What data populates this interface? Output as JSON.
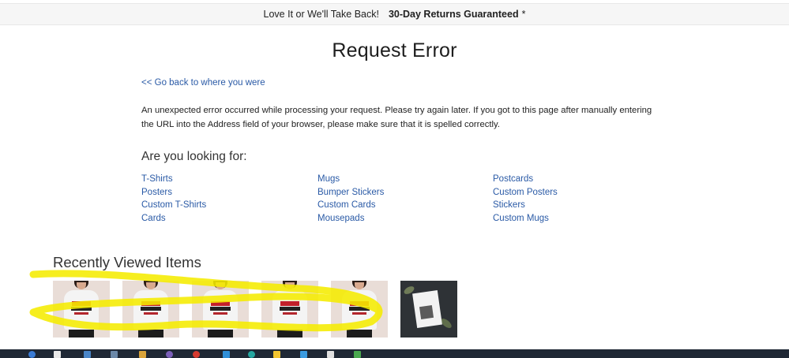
{
  "promo": {
    "text": "Love It or We'll Take Back!",
    "strong": "30-Day Returns Guaranteed",
    "asterisk": "*"
  },
  "title": "Request Error",
  "back_link": "<< Go back to where you were",
  "error_message": "An unexpected error occurred while processing your request. Please try again later. If you got to this page after manually entering the URL into the Address field of your browser, please make sure that it is spelled correctly.",
  "looking_for": {
    "title": "Are you looking for:",
    "columns": [
      [
        "T-Shirts",
        "Posters",
        "Custom T-Shirts",
        "Cards"
      ],
      [
        "Mugs",
        "Bumper Stickers",
        "Custom Cards",
        "Mousepads"
      ],
      [
        "Postcards",
        "Custom Posters",
        "Stickers",
        "Custom Mugs"
      ]
    ]
  },
  "recently_viewed": {
    "title": "Recently Viewed Items",
    "items": [
      {
        "kind": "t-shirt-woman"
      },
      {
        "kind": "t-shirt-woman"
      },
      {
        "kind": "t-shirt-woman"
      },
      {
        "kind": "t-shirt-woman"
      },
      {
        "kind": "t-shirt-woman"
      },
      {
        "kind": "card-photo"
      }
    ]
  },
  "annotation": {
    "color": "#f5ec00"
  },
  "colors": {
    "link": "#2a5aa6",
    "promo_bg": "#f6f6f6",
    "taskbar": "#1f2835"
  }
}
